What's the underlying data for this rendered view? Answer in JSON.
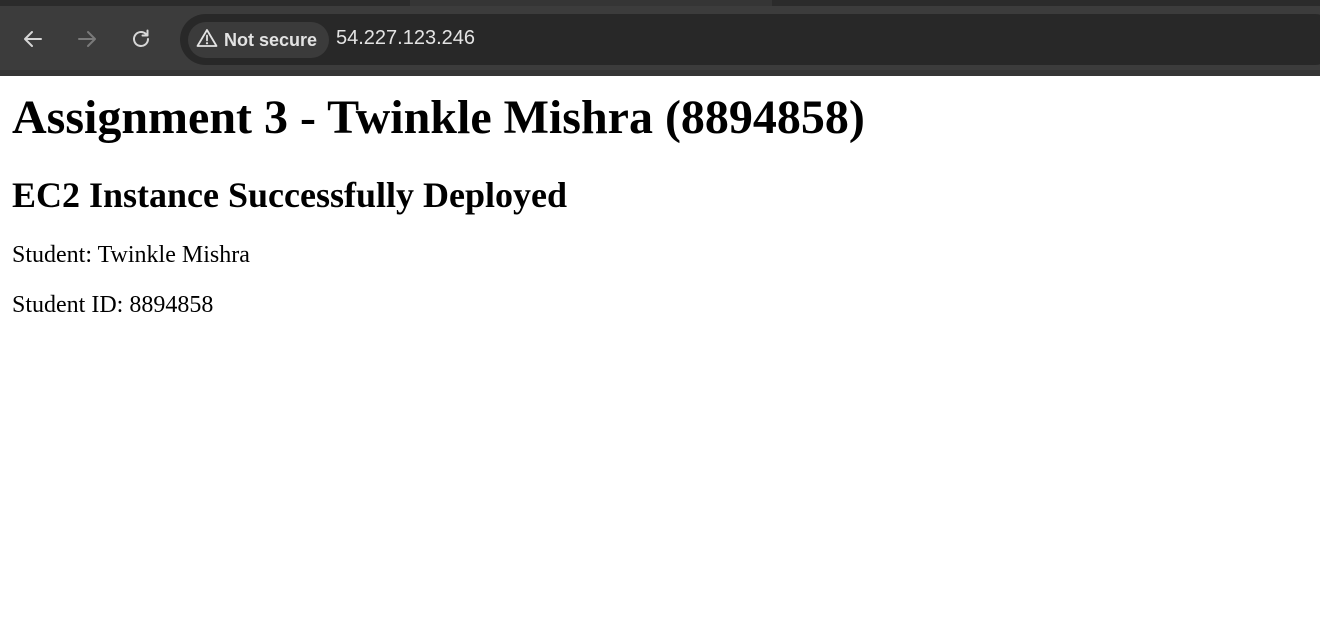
{
  "browser": {
    "security_label": "Not secure",
    "url": "54.227.123.246",
    "icons": {
      "back": "arrow-left-icon",
      "forward": "arrow-right-icon",
      "reload": "reload-icon",
      "warning": "warning-triangle-icon"
    },
    "colors": {
      "toolbar": "#3c3c3c",
      "omnibox": "#282828",
      "chip": "#3b3b3b",
      "text": "#e3e3e3"
    }
  },
  "page": {
    "heading": "Assignment 3 - Twinkle Mishra (8894858)",
    "subheading": "EC2 Instance Successfully Deployed",
    "student_line": "Student: Twinkle Mishra",
    "student_id_line": "Student ID: 8894858"
  }
}
